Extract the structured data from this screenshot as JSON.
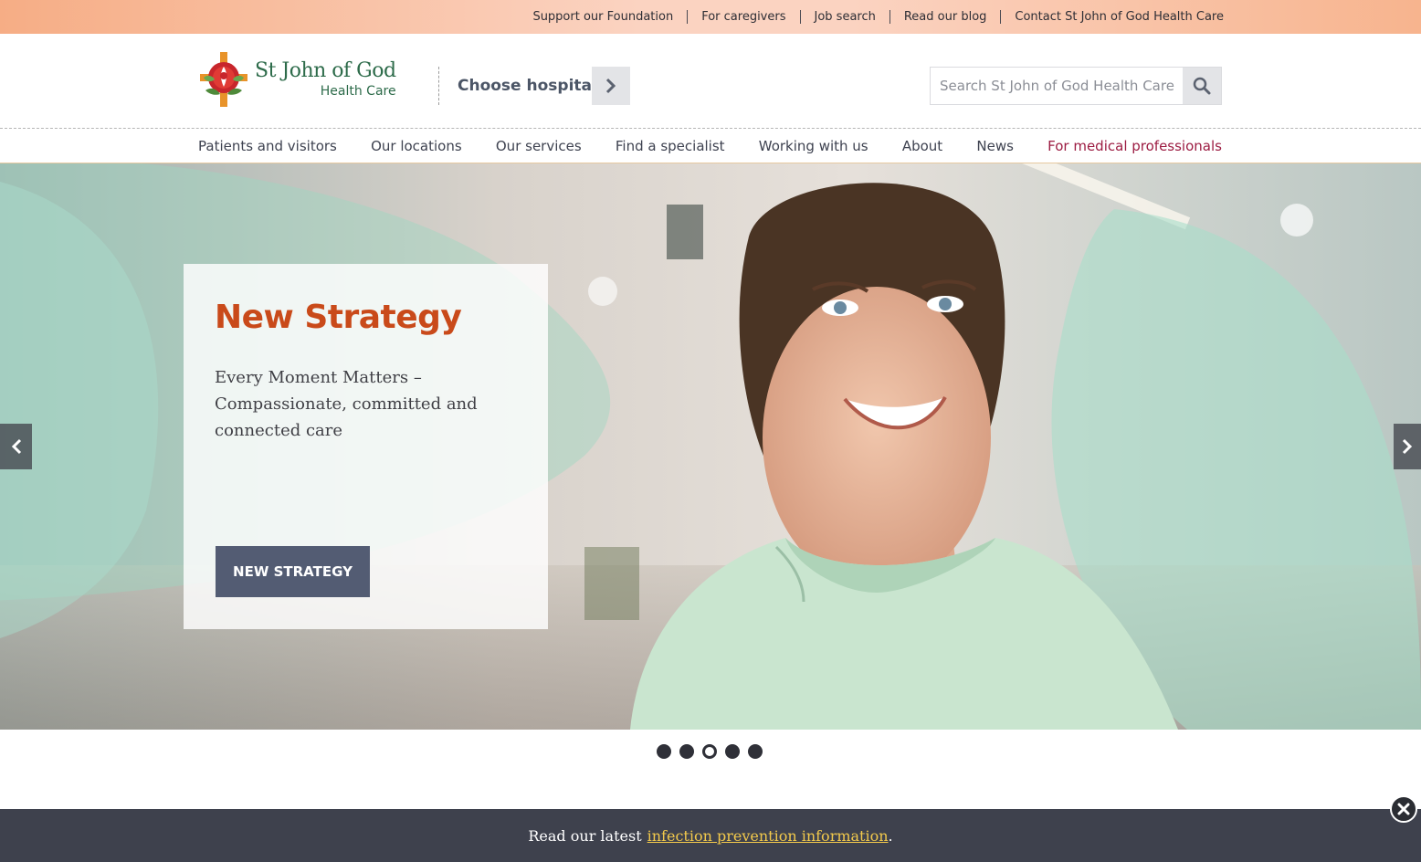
{
  "utility_nav": [
    {
      "label": "Support our Foundation"
    },
    {
      "label": "For caregivers"
    },
    {
      "label": "Job search"
    },
    {
      "label": "Read our blog"
    },
    {
      "label": "Contact St John of God Health Care"
    }
  ],
  "header": {
    "logo_name": "St John of God",
    "logo_sub": "Health Care",
    "choose_hospital": "Choose hospital",
    "search_placeholder": "Search St John of God Health Care"
  },
  "main_nav": [
    {
      "label": "Patients and visitors"
    },
    {
      "label": "Our locations"
    },
    {
      "label": "Our services"
    },
    {
      "label": "Find a specialist"
    },
    {
      "label": "Working with us"
    },
    {
      "label": "About"
    },
    {
      "label": "News"
    },
    {
      "label": "For medical professionals"
    }
  ],
  "hero": {
    "title": "New Strategy",
    "text": "Every Moment Matters – Compassionate, committed and connected care",
    "cta": "NEW STRATEGY",
    "slides_total": 5,
    "active_slide": 3
  },
  "alert": {
    "prefix": "Read our latest",
    "link": "infection prevention information",
    "suffix": "."
  },
  "colors": {
    "brand_green": "#2d6b4a",
    "accent_orange": "#c94a1a",
    "medical_link": "#9c1c42",
    "button_slate": "#535c73",
    "alert_bg": "#3e414d",
    "alert_link": "#f2c94c"
  },
  "icons": {
    "choose_hospital": "chevron-right-icon",
    "search": "search-icon",
    "prev": "chevron-left-icon",
    "next": "chevron-right-icon",
    "close": "close-icon"
  }
}
